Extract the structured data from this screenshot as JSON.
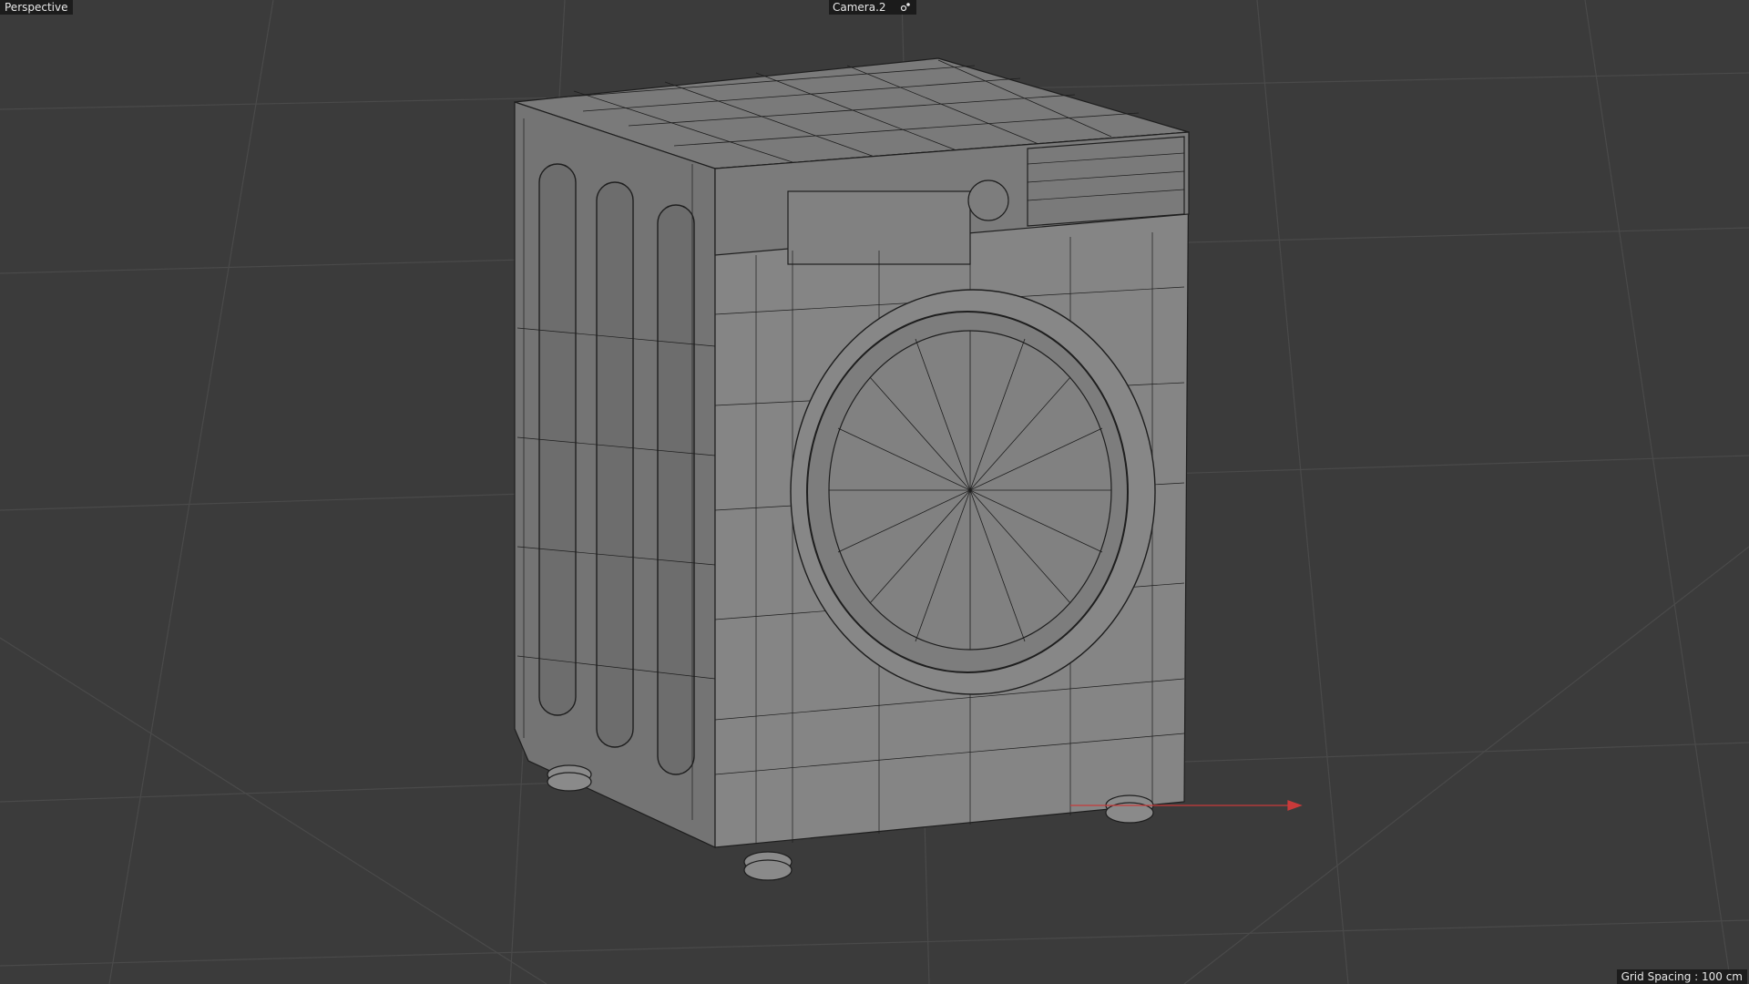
{
  "viewport": {
    "view_name": "Perspective",
    "camera_name": "Camera.2",
    "grid_spacing_text": "Grid Spacing : 100 cm"
  },
  "icons": {
    "camera": "camera-target-icon"
  },
  "colors": {
    "background": "#3b3b3b",
    "grid_line": "#4a4a4a",
    "model_face": "#808080",
    "wire": "#1e1e1e",
    "x_axis": "#c83a3a",
    "hud_bg": "#181818",
    "hud_text": "#e8e8e8"
  }
}
